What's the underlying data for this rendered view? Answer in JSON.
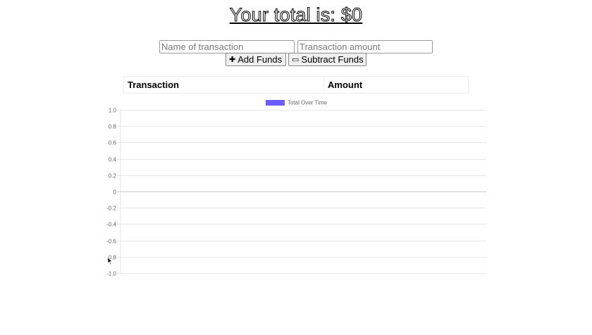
{
  "header": {
    "title": "Your total is: $0"
  },
  "form": {
    "name_placeholder": "Name of transaction",
    "amount_placeholder": "Transaction amount",
    "add_icon": "plus-icon",
    "add_label": "Add Funds",
    "subtract_icon": "minus-icon",
    "subtract_label": "Subtract Funds"
  },
  "table": {
    "columns": [
      "Transaction",
      "Amount"
    ],
    "rows": []
  },
  "colors": {
    "series": "#6b5cff",
    "grid": "#e6e6e6",
    "zero_line": "#c8c8c8",
    "tick_text": "#666666"
  },
  "chart_data": {
    "type": "line",
    "title": "",
    "xlabel": "",
    "ylabel": "",
    "x": [],
    "series": [
      {
        "name": "Total Over Time",
        "values": []
      }
    ],
    "ylim": [
      -1.0,
      1.0
    ],
    "yticks": [
      "1.0",
      "0.8",
      "0.6",
      "0.4",
      "0.2",
      "0",
      "-0.2",
      "-0.4",
      "-0.6",
      "-0.8",
      "-1.0"
    ],
    "grid": true,
    "legend": "top-center"
  }
}
